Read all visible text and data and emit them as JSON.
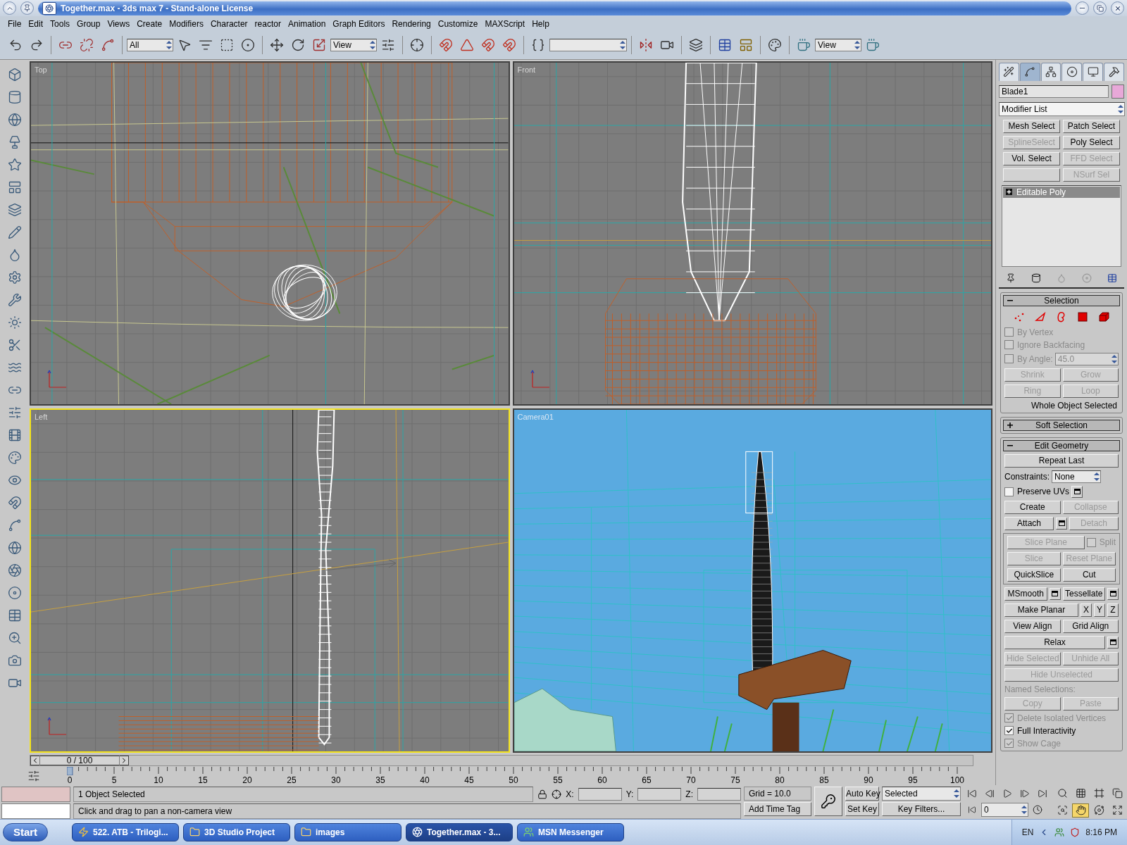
{
  "window": {
    "title": "Together.max - 3ds max 7  - Stand-alone License"
  },
  "menu": [
    "File",
    "Edit",
    "Tools",
    "Group",
    "Views",
    "Create",
    "Modifiers",
    "Character",
    "reactor",
    "Animation",
    "Graph Editors",
    "Rendering",
    "Customize",
    "MAXScript",
    "Help"
  ],
  "toolbar": {
    "selection_filter": "All",
    "coord_system": "View",
    "render_view": "View"
  },
  "viewports": [
    {
      "label": "Top",
      "kind": "top",
      "selected": false
    },
    {
      "label": "Front",
      "kind": "front",
      "selected": false
    },
    {
      "label": "Left",
      "kind": "left",
      "selected": true
    },
    {
      "label": "Camera01",
      "kind": "camera",
      "selected": false
    }
  ],
  "command_panel": {
    "tabs": [
      {
        "kind": "create",
        "selected": false
      },
      {
        "kind": "modify",
        "selected": true
      },
      {
        "kind": "hierarchy",
        "selected": false
      },
      {
        "kind": "motion",
        "selected": false
      },
      {
        "kind": "display",
        "selected": false
      },
      {
        "kind": "utilities",
        "selected": false
      }
    ],
    "object_name": "Blade1",
    "modifier_list": "Modifier List",
    "modifier_buttons": [
      {
        "kind": "button",
        "label": "Mesh Select",
        "disabled": false
      },
      {
        "kind": "button",
        "label": "Patch Select",
        "disabled": false
      },
      {
        "kind": "button",
        "label": "SplineSelect",
        "disabled": true
      },
      {
        "kind": "button",
        "label": "Poly Select",
        "disabled": false
      },
      {
        "kind": "button",
        "label": "Vol. Select",
        "disabled": false
      },
      {
        "kind": "button",
        "label": "FFD Select",
        "disabled": true
      },
      {
        "kind": "blank"
      },
      {
        "kind": "button",
        "label": "NSurf Sel",
        "disabled": true
      }
    ],
    "stack": [
      {
        "label": "Editable Poly",
        "selected": true
      }
    ],
    "selection": {
      "title": "Selection",
      "expanded": true,
      "levels": [
        {
          "kind": "vertex",
          "selected": false
        },
        {
          "kind": "edge",
          "selected": false
        },
        {
          "kind": "border",
          "selected": false
        },
        {
          "kind": "polygon",
          "selected": false
        },
        {
          "kind": "element",
          "selected": false
        }
      ],
      "rows": [
        {
          "items": [
            {
              "kind": "checkbox",
              "label": "By Vertex",
              "checked": false,
              "disabled": true
            }
          ]
        },
        {
          "items": [
            {
              "kind": "checkbox",
              "label": "Ignore Backfacing",
              "checked": false,
              "disabled": true
            }
          ]
        },
        {
          "items": [
            {
              "kind": "checkbox",
              "label": "By Angle:",
              "checked": false,
              "disabled": true
            },
            {
              "kind": "spinner",
              "value": "45.0",
              "disabled": true
            }
          ]
        },
        {
          "items": [
            {
              "kind": "button",
              "label": "Shrink",
              "disabled": true
            },
            {
              "kind": "button",
              "label": "Grow",
              "disabled": true
            }
          ]
        },
        {
          "items": [
            {
              "kind": "button",
              "label": "Ring",
              "disabled": true
            },
            {
              "kind": "button",
              "label": "Loop",
              "disabled": true
            }
          ]
        }
      ],
      "status": "Whole Object Selected"
    },
    "soft_selection": {
      "title": "Soft Selection",
      "expanded": false
    },
    "edit_geometry": {
      "title": "Edit Geometry",
      "expanded": true,
      "blocks": [
        {
          "kind": "rows",
          "rows": [
            {
              "items": [
                {
                  "kind": "button",
                  "label": "Repeat Last",
                  "disabled": false
                }
              ]
            },
            {
              "items": [
                {
                  "kind": "label",
                  "label": "Constraints:",
                  "disabled": false
                },
                {
                  "kind": "dropdown",
                  "value": "None",
                  "disabled": false
                }
              ]
            },
            {
              "items": [
                {
                  "kind": "checkbox",
                  "label": "Preserve UVs",
                  "checked": false,
                  "disabled": false
                },
                {
                  "kind": "settings",
                  "disabled": false
                }
              ]
            },
            {
              "items": [
                {
                  "kind": "button",
                  "label": "Create",
                  "disabled": false
                },
                {
                  "kind": "button",
                  "label": "Collapse",
                  "disabled": true
                }
              ]
            },
            {
              "items": [
                {
                  "kind": "button",
                  "label": "Attach",
                  "disabled": false
                },
                {
                  "kind": "settings",
                  "disabled": false
                },
                {
                  "kind": "button",
                  "label": "Detach",
                  "disabled": true
                }
              ]
            }
          ]
        },
        {
          "kind": "group",
          "rows": [
            {
              "items": [
                {
                  "kind": "button",
                  "label": "Slice Plane",
                  "disabled": true
                },
                {
                  "kind": "checkbox",
                  "label": "Split",
                  "checked": false,
                  "disabled": true
                }
              ]
            },
            {
              "items": [
                {
                  "kind": "button",
                  "label": "Slice",
                  "disabled": true
                },
                {
                  "kind": "button",
                  "label": "Reset Plane",
                  "disabled": true
                }
              ]
            },
            {
              "items": [
                {
                  "kind": "button",
                  "label": "QuickSlice",
                  "disabled": false
                },
                {
                  "kind": "button",
                  "label": "Cut",
                  "disabled": false
                }
              ]
            }
          ]
        },
        {
          "kind": "rows",
          "rows": [
            {
              "items": [
                {
                  "kind": "button",
                  "label": "MSmooth",
                  "disabled": false
                },
                {
                  "kind": "settings",
                  "disabled": false
                },
                {
                  "kind": "button",
                  "label": "Tessellate",
                  "disabled": false
                },
                {
                  "kind": "settings",
                  "disabled": false
                }
              ]
            },
            {
              "items": [
                {
                  "kind": "button",
                  "label": "Make Planar",
                  "disabled": false
                },
                {
                  "kind": "axis",
                  "label": "X",
                  "disabled": false
                },
                {
                  "kind": "axis",
                  "label": "Y",
                  "disabled": false
                },
                {
                  "kind": "axis",
                  "label": "Z",
                  "disabled": false
                }
              ]
            },
            {
              "items": [
                {
                  "kind": "button",
                  "label": "View Align",
                  "disabled": false
                },
                {
                  "kind": "button",
                  "label": "Grid Align",
                  "disabled": false
                }
              ]
            },
            {
              "items": [
                {
                  "kind": "button",
                  "label": "Relax",
                  "disabled": false
                },
                {
                  "kind": "settings",
                  "disabled": false
                }
              ]
            },
            {
              "items": [
                {
                  "kind": "button",
                  "label": "Hide Selected",
                  "disabled": true
                },
                {
                  "kind": "button",
                  "label": "Unhide All",
                  "disabled": true
                }
              ]
            },
            {
              "items": [
                {
                  "kind": "button",
                  "label": "Hide Unselected",
                  "disabled": true
                }
              ]
            },
            {
              "items": [
                {
                  "kind": "label",
                  "label": "Named Selections:",
                  "disabled": true
                }
              ]
            },
            {
              "items": [
                {
                  "kind": "button",
                  "label": "Copy",
                  "disabled": true
                },
                {
                  "kind": "button",
                  "label": "Paste",
                  "disabled": true
                }
              ]
            },
            {
              "items": [
                {
                  "kind": "checkbox",
                  "label": "Delete Isolated Vertices",
                  "checked": true,
                  "disabled": true
                }
              ]
            },
            {
              "items": [
                {
                  "kind": "checkbox",
                  "label": "Full Interactivity",
                  "checked": true,
                  "disabled": false
                }
              ]
            },
            {
              "items": [
                {
                  "kind": "checkbox",
                  "label": "Show Cage",
                  "checked": true,
                  "disabled": true
                }
              ]
            }
          ]
        }
      ]
    }
  },
  "time_slider": "0 / 100",
  "ruler_labels": [
    "0",
    "5",
    "10",
    "15",
    "20",
    "25",
    "30",
    "35",
    "40",
    "45",
    "50",
    "55",
    "60",
    "65",
    "70",
    "75",
    "80",
    "85",
    "90",
    "95",
    "100"
  ],
  "status": {
    "selection_count": "1 Object Selected",
    "prompt": "Click and drag to pan a non-camera view",
    "coords": [
      {
        "label": "X:"
      },
      {
        "label": "Y:"
      },
      {
        "label": "Z:"
      }
    ],
    "grid": "Grid = 10.0",
    "time_tag": "Add Time Tag",
    "auto_key": "Auto Key",
    "set_key": "Set Key",
    "key_mode": "Selected",
    "key_filters": "Key Filters...",
    "frame": "0",
    "nav": [
      {
        "kind": "zoom",
        "selected": false
      },
      {
        "kind": "zoom_all",
        "selected": false
      },
      {
        "kind": "extents",
        "selected": false
      },
      {
        "kind": "extents_all",
        "selected": false
      },
      {
        "kind": "region",
        "selected": false
      },
      {
        "kind": "pan",
        "selected": true
      },
      {
        "kind": "orbit",
        "selected": false
      },
      {
        "kind": "maximize",
        "selected": false
      }
    ]
  },
  "taskbar": {
    "start": "Start",
    "tasks": [
      {
        "label": "522. ATB - Trilogi...",
        "kind": "media",
        "selected": false
      },
      {
        "label": "3D Studio Project",
        "kind": "folder",
        "selected": false
      },
      {
        "label": "images",
        "kind": "folder",
        "selected": false
      },
      {
        "label": "Together.max - 3...",
        "kind": "app",
        "selected": true
      },
      {
        "label": "MSN Messenger",
        "kind": "messenger",
        "selected": false
      }
    ],
    "language": "EN",
    "clock": "8:16 PM"
  }
}
